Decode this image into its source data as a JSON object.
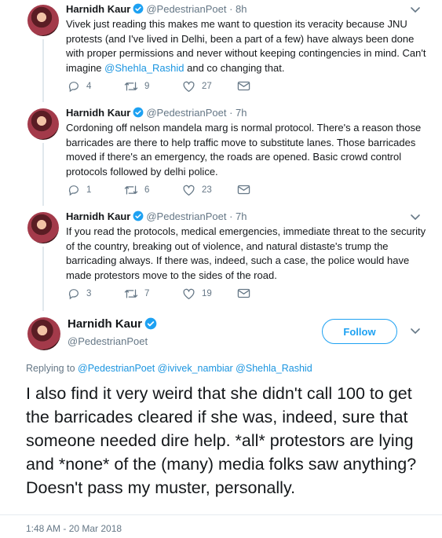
{
  "replies": [
    {
      "name": "Harnidh Kaur",
      "handle": "@PedestrianPoet",
      "time": "· 8h",
      "text_parts": [
        "Vivek just reading this makes me want to question its veracity because JNU protests (and I've lived in Delhi, been a part of a few) have always been done with proper permissions and never without keeping contingencies in mind. Can't imagine ",
        "@Shehla_Rashid",
        " and co changing that."
      ],
      "replies": "4",
      "retweets": "9",
      "likes": "27"
    },
    {
      "name": "Harnidh Kaur",
      "handle": "@PedestrianPoet",
      "time": "· 7h",
      "text": "Cordoning off nelson mandela marg is normal protocol. There's a reason those barricades are there to help traffic move to substitute lanes. Those barricades moved if there's an emergency, the roads are opened. Basic crowd control protocols followed by delhi police.",
      "replies": "1",
      "retweets": "6",
      "likes": "23"
    },
    {
      "name": "Harnidh Kaur",
      "handle": "@PedestrianPoet",
      "time": "· 7h",
      "text": "If you read the protocols, medical emergencies, immediate threat to the security of the country, breaking out of violence, and natural distaste's trump the barricading always. If there was, indeed, such a case, the police would have made protestors move to the sides of the road.",
      "replies": "3",
      "retweets": "7",
      "likes": "19"
    }
  ],
  "main": {
    "name": "Harnidh Kaur",
    "handle": "@PedestrianPoet",
    "follow_label": "Follow",
    "replying_prefix": "Replying to ",
    "replying_mentions": "@PedestrianPoet @ivivek_nambiar @Shehla_Rashid",
    "text": "I also find it very weird that she didn't call 100 to get the barricades cleared if she was, indeed, sure that someone needed dire help. *all* protestors are lying and *none* of the (many) media folks saw anything? Doesn't pass my muster, personally.",
    "timestamp": "1:48 AM - 20 Mar 2018"
  },
  "colors": {
    "accent": "#1da1f2",
    "muted": "#657786",
    "text": "#14171a"
  }
}
